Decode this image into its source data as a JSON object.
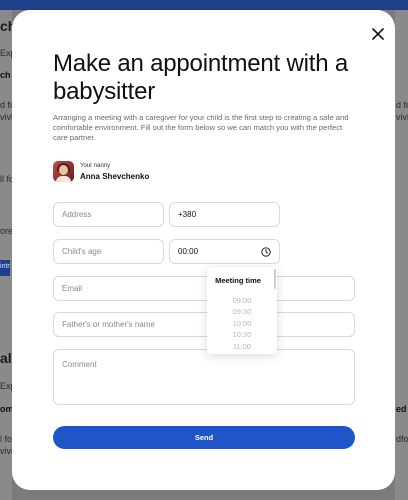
{
  "background": {
    "fragments_left": [
      "ch",
      "Exp",
      "ch",
      "d fo",
      "vivi",
      "ll fo",
      "ore",
      "intr",
      "ale",
      "Exp",
      "om",
      "l fo",
      "vivi"
    ],
    "fragments_right": [
      "d fo",
      "vivi",
      "ed",
      "dfo"
    ]
  },
  "modal": {
    "title": "Make an appointment with a babysitter",
    "description": "Arranging a meeting with a caregiver for your child is the first step to creating a safe and comfortable environment. Fill out the form below so we can match you with the perfect care partner.",
    "nanny": {
      "label": "Your nanny",
      "name": "Anna Shevchenko"
    },
    "form": {
      "address_placeholder": "Address",
      "phone_value": "+380",
      "child_age_placeholder": "Child's age",
      "time_value": "00:00",
      "email_placeholder": "Email",
      "parent_name_placeholder": "Father's or mother's name",
      "comment_placeholder": "Comment"
    },
    "time_picker": {
      "header": "Meeting time",
      "options": [
        "09:00",
        "09:30",
        "10:00",
        "10:30",
        "11:00"
      ]
    },
    "send_label": "Send"
  },
  "colors": {
    "accent": "#1f55c8",
    "overlay": "#7b7b7b"
  }
}
